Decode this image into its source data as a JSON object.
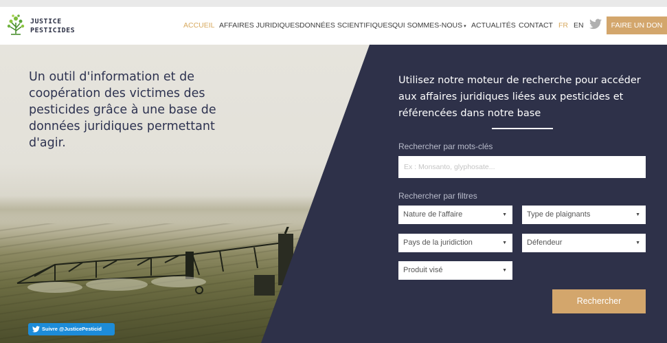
{
  "brand": {
    "line1": "JUSTICE",
    "line2": "PESTICIDES"
  },
  "nav": {
    "items": [
      {
        "label": "ACCUEIL",
        "active": true
      },
      {
        "label": "AFFAIRES JURIDIQUES"
      },
      {
        "label": "DONNÉES SCIENTIFIQUES"
      },
      {
        "label": "QUI SOMMES-NOUS",
        "has_dropdown": true
      },
      {
        "label": "ACTUALITÉS"
      },
      {
        "label": "CONTACT"
      }
    ],
    "lang_fr": "FR",
    "lang_en": "EN",
    "twitter_icon": "twitter-icon",
    "donate_label": "FAIRE UN DON"
  },
  "hero": {
    "tagline": "Un outil d'information et de coopération des victimes des pesticides grâce à une base de données juridiques permettant d'agir.",
    "follow_label": "Suivre @JusticePesticid"
  },
  "search": {
    "intro": "Utilisez notre moteur de recherche pour accéder aux affaires juridiques liées aux pesticides et référencées dans notre base",
    "keywords_label": "Rechercher par mots-clés",
    "keywords_placeholder": "Ex : Monsanto, glyphosate...",
    "keywords_value": "",
    "filters_label": "Rechercher par filtres",
    "filters": [
      {
        "label": "Nature de l'affaire"
      },
      {
        "label": "Type de plaignants"
      },
      {
        "label": "Pays de la juridiction"
      },
      {
        "label": "Défendeur"
      },
      {
        "label": "Produit visé"
      }
    ],
    "submit_label": "Rechercher"
  },
  "colors": {
    "accent": "#d3a66c",
    "panel": "#2e3149",
    "twitter": "#1d8cd9"
  }
}
